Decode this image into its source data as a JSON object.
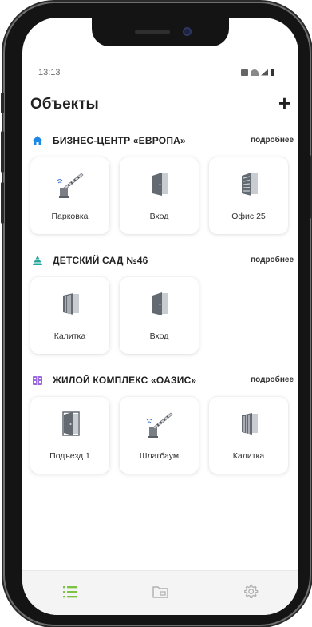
{
  "status": {
    "time": "13:13"
  },
  "header": {
    "title": "Объекты",
    "add_label": "+"
  },
  "groups": [
    {
      "name": "БИЗНЕС-ЦЕНТР «ЕВРОПА»",
      "more_label": "подробнее",
      "icon": "home-icon",
      "icon_color": "#1e88e5",
      "tiles": [
        {
          "label": "Парковка",
          "icon": "barrier-gate-icon"
        },
        {
          "label": "Вход",
          "icon": "door-icon"
        },
        {
          "label": "Офис 25",
          "icon": "office-door-icon"
        }
      ]
    },
    {
      "name": "ДЕТСКИЙ САД №46",
      "more_label": "подробнее",
      "icon": "pyramid-icon",
      "icon_color": "#26a69a",
      "tiles": [
        {
          "label": "Калитка",
          "icon": "wicket-gate-icon"
        },
        {
          "label": "Вход",
          "icon": "door-icon"
        }
      ]
    },
    {
      "name": "ЖИЛОЙ КОМПЛЕКС «ОАЗИС»",
      "more_label": "подробнее",
      "icon": "building-icon",
      "icon_color": "#9c6ade",
      "tiles": [
        {
          "label": "Подъезд 1",
          "icon": "entrance-door-icon"
        },
        {
          "label": "Шлагбаум",
          "icon": "barrier-gate-icon"
        },
        {
          "label": "Калитка",
          "icon": "wicket-gate-icon"
        }
      ]
    }
  ],
  "tabbar": {
    "tabs": [
      {
        "icon": "list-icon",
        "active": true
      },
      {
        "icon": "folder-icon",
        "active": false
      },
      {
        "icon": "gear-icon",
        "active": false
      }
    ],
    "active_color": "#7cc243",
    "inactive_color": "#b0b0b0"
  }
}
